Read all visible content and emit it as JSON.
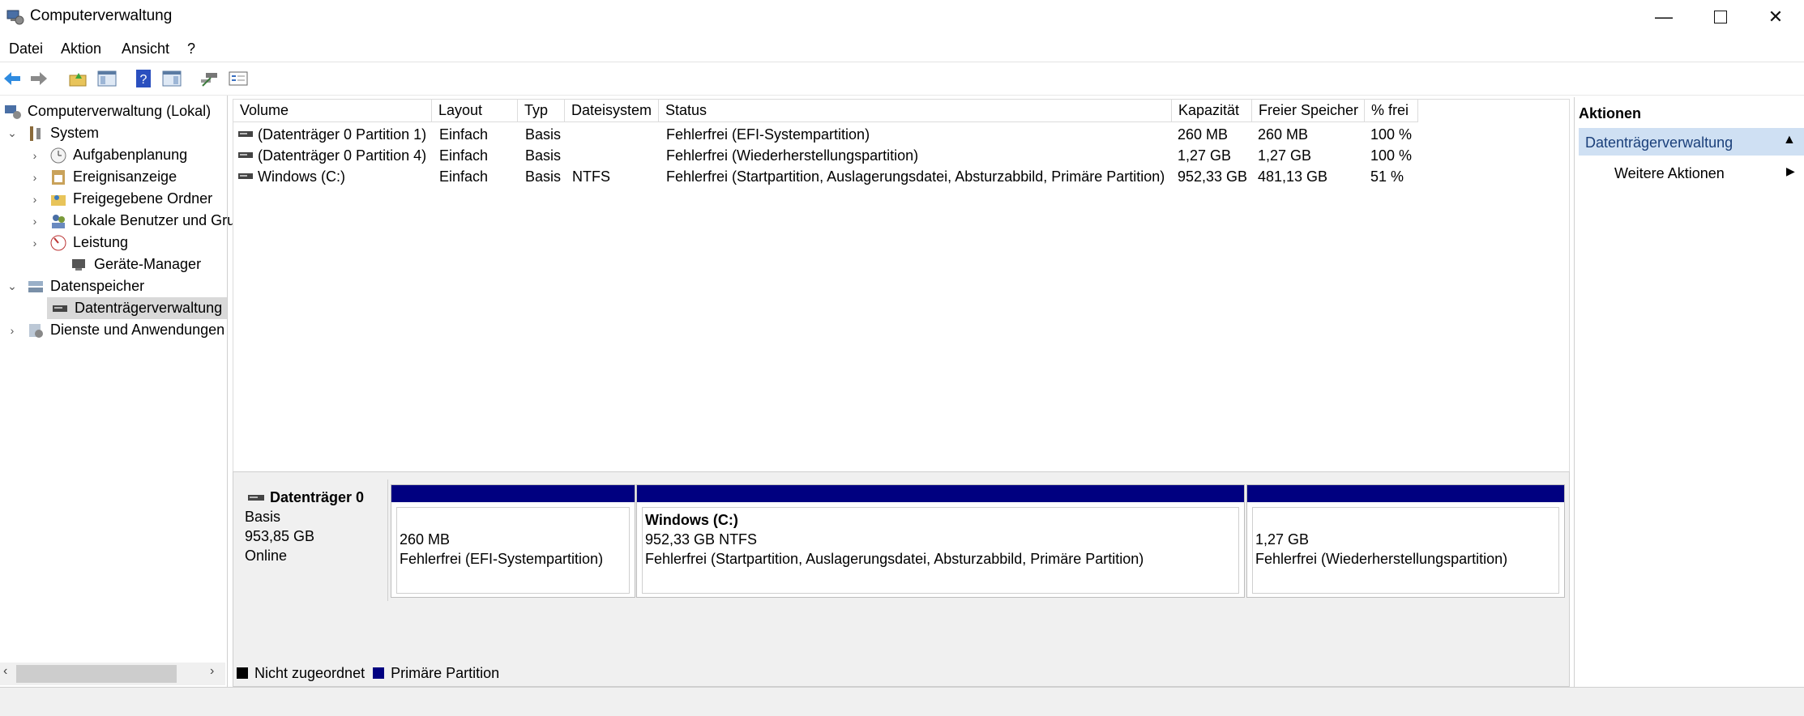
{
  "window": {
    "title": "Computerverwaltung",
    "app_icon": "computer-management-icon",
    "controls": [
      "minimize-icon",
      "maximize-icon",
      "close-icon"
    ]
  },
  "menu": [
    "Datei",
    "Aktion",
    "Ansicht",
    "?"
  ],
  "toolbar": {
    "buttons": [
      "back-arrow-icon",
      "forward-arrow-icon",
      "up-folder-icon",
      "show-hide-console-tree-icon",
      "help-icon",
      "show-hide-action-pane-icon",
      "connect-icon",
      "properties-icon"
    ]
  },
  "tree": {
    "root": "Computerverwaltung (Lokal)",
    "system": "System",
    "system_children": [
      "Aufgabenplanung",
      "Ereignisanzeige",
      "Freigegebene Ordner",
      "Lokale Benutzer und Gru",
      "Leistung",
      "Geräte-Manager"
    ],
    "storage": "Datenspeicher",
    "storage_child": "Datenträgerverwaltung",
    "services": "Dienste und Anwendungen"
  },
  "volumes": {
    "columns": [
      "Volume",
      "Layout",
      "Typ",
      "Dateisystem",
      "Status",
      "Kapazität",
      "Freier Speicher",
      "% frei"
    ],
    "rows": [
      [
        "(Datenträger 0 Partition 1)",
        "Einfach",
        "Basis",
        "",
        "Fehlerfrei (EFI-Systempartition)",
        "260 MB",
        "260 MB",
        "100 %"
      ],
      [
        "(Datenträger 0 Partition 4)",
        "Einfach",
        "Basis",
        "",
        "Fehlerfrei (Wiederherstellungspartition)",
        "1,27 GB",
        "1,27 GB",
        "100 %"
      ],
      [
        "Windows (C:)",
        "Einfach",
        "Basis",
        "NTFS",
        "Fehlerfrei (Startpartition, Auslagerungsdatei, Absturzabbild, Primäre Partition)",
        "952,33 GB",
        "481,13 GB",
        "51 %"
      ]
    ]
  },
  "disk": {
    "name": "Datenträger 0",
    "type": "Basis",
    "size": "953,85 GB",
    "state": "Online",
    "partitions": [
      {
        "title": "",
        "size": "260 MB",
        "status": "Fehlerfrei (EFI-Systempartition)"
      },
      {
        "title": "Windows  (C:)",
        "size": "952,33 GB NTFS",
        "status": "Fehlerfrei (Startpartition, Auslagerungsdatei, Absturzabbild, Primäre Partition)"
      },
      {
        "title": "",
        "size": "1,27 GB",
        "status": "Fehlerfrei (Wiederherstellungspartition)"
      }
    ]
  },
  "legend": [
    {
      "label": "Nicht zugeordnet",
      "color": "#000000"
    },
    {
      "label": "Primäre Partition",
      "color": "#000080"
    }
  ],
  "actions": {
    "header": "Aktionen",
    "section": "Datenträgerverwaltung",
    "more": "Weitere Aktionen"
  }
}
